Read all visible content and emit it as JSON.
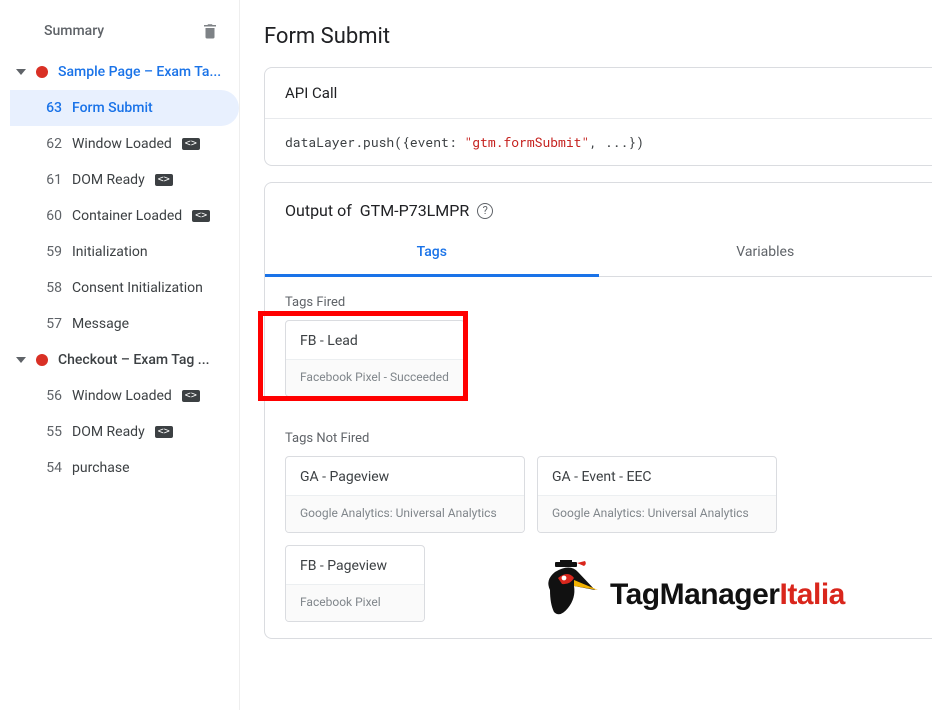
{
  "sidebar": {
    "summary_label": "Summary",
    "groups": [
      {
        "title": "Sample Page – Exam Ta...",
        "is_primary": true,
        "events": [
          {
            "num": "63",
            "label": "Form Submit",
            "badge": false,
            "active": true
          },
          {
            "num": "62",
            "label": "Window Loaded",
            "badge": true,
            "active": false
          },
          {
            "num": "61",
            "label": "DOM Ready",
            "badge": true,
            "active": false
          },
          {
            "num": "60",
            "label": "Container Loaded",
            "badge": true,
            "active": false
          },
          {
            "num": "59",
            "label": "Initialization",
            "badge": false,
            "active": false
          },
          {
            "num": "58",
            "label": "Consent Initialization",
            "badge": false,
            "active": false
          },
          {
            "num": "57",
            "label": "Message",
            "badge": false,
            "active": false
          }
        ]
      },
      {
        "title": "Checkout – Exam Tag ...",
        "is_primary": false,
        "events": [
          {
            "num": "56",
            "label": "Window Loaded",
            "badge": true,
            "active": false
          },
          {
            "num": "55",
            "label": "DOM Ready",
            "badge": true,
            "active": false
          },
          {
            "num": "54",
            "label": "purchase",
            "badge": false,
            "active": false
          }
        ]
      }
    ]
  },
  "main": {
    "heading": "Form Submit",
    "api_call": {
      "title": "API Call",
      "code_prefix": "dataLayer.push({event: ",
      "code_string": "\"gtm.formSubmit\"",
      "code_suffix": ", ...})"
    },
    "output": {
      "title_prefix": "Output of ",
      "container_id": "GTM-P73LMPR",
      "tabs": {
        "tags": "Tags",
        "variables": "Variables"
      },
      "fired_label": "Tags Fired",
      "fired": [
        {
          "name": "FB - Lead",
          "meta": "Facebook Pixel - Succeeded"
        }
      ],
      "not_fired_label": "Tags Not Fired",
      "not_fired": [
        {
          "name": "GA - Pageview",
          "meta": "Google Analytics: Universal Analytics"
        },
        {
          "name": "GA - Event - EEC",
          "meta": "Google Analytics: Universal Analytics"
        },
        {
          "name": "FB - Pageview",
          "meta": "Facebook Pixel"
        }
      ]
    }
  },
  "logo": {
    "text_black": "TagManager",
    "text_red": "Italia"
  }
}
